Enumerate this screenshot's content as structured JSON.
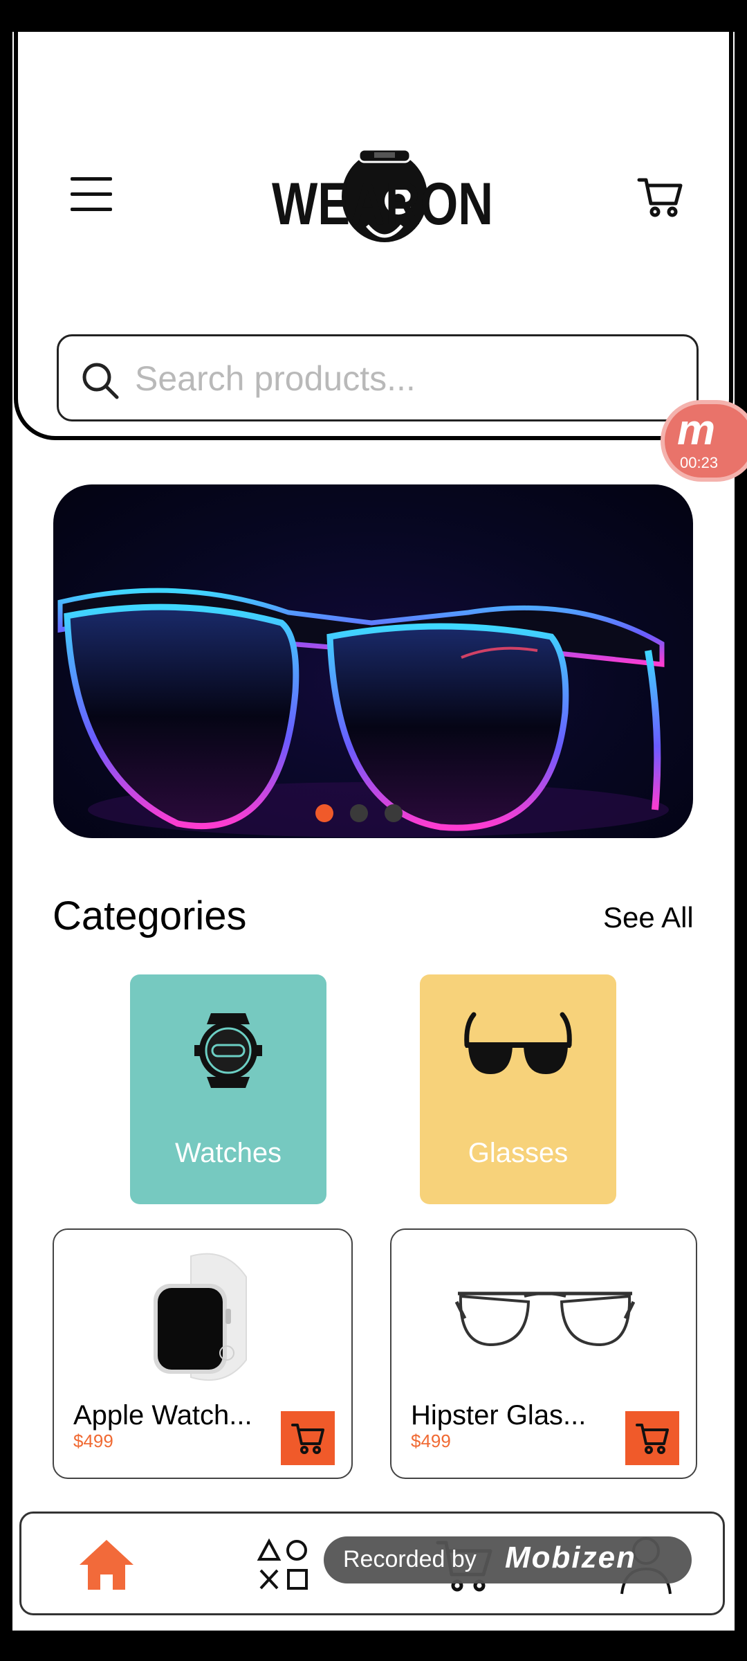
{
  "header": {
    "logo_text": "WEARON",
    "search_placeholder": "Search products..."
  },
  "recording_badge": {
    "letter": "m",
    "time": "00:23"
  },
  "banner": {
    "image": "neon-glasses",
    "slide_count": 3,
    "active_slide": 1
  },
  "colors": {
    "accent": "#f05a2a",
    "watches_bg": "#76c9c0",
    "glasses_bg": "#f7d27a",
    "price": "#f06a33"
  },
  "categories": {
    "title": "Categories",
    "see_all": "See All",
    "items": [
      {
        "label": "Watches",
        "icon": "watch-icon"
      },
      {
        "label": "Glasses",
        "icon": "sunglasses-icon"
      }
    ]
  },
  "products": [
    {
      "name": "Apple Watch...",
      "price": "$499",
      "image": "apple-watch"
    },
    {
      "name": "Hipster Glas...",
      "price": "$499",
      "image": "hipster-glasses"
    }
  ],
  "bottom_nav": [
    {
      "name": "home",
      "icon": "home-icon",
      "active": true
    },
    {
      "name": "categories",
      "icon": "shapes-icon",
      "active": false
    },
    {
      "name": "cart",
      "icon": "cart-icon",
      "active": false
    },
    {
      "name": "profile",
      "icon": "user-icon",
      "active": false
    }
  ],
  "watermark": {
    "prefix": "Recorded by",
    "brand": "Mobizen"
  }
}
